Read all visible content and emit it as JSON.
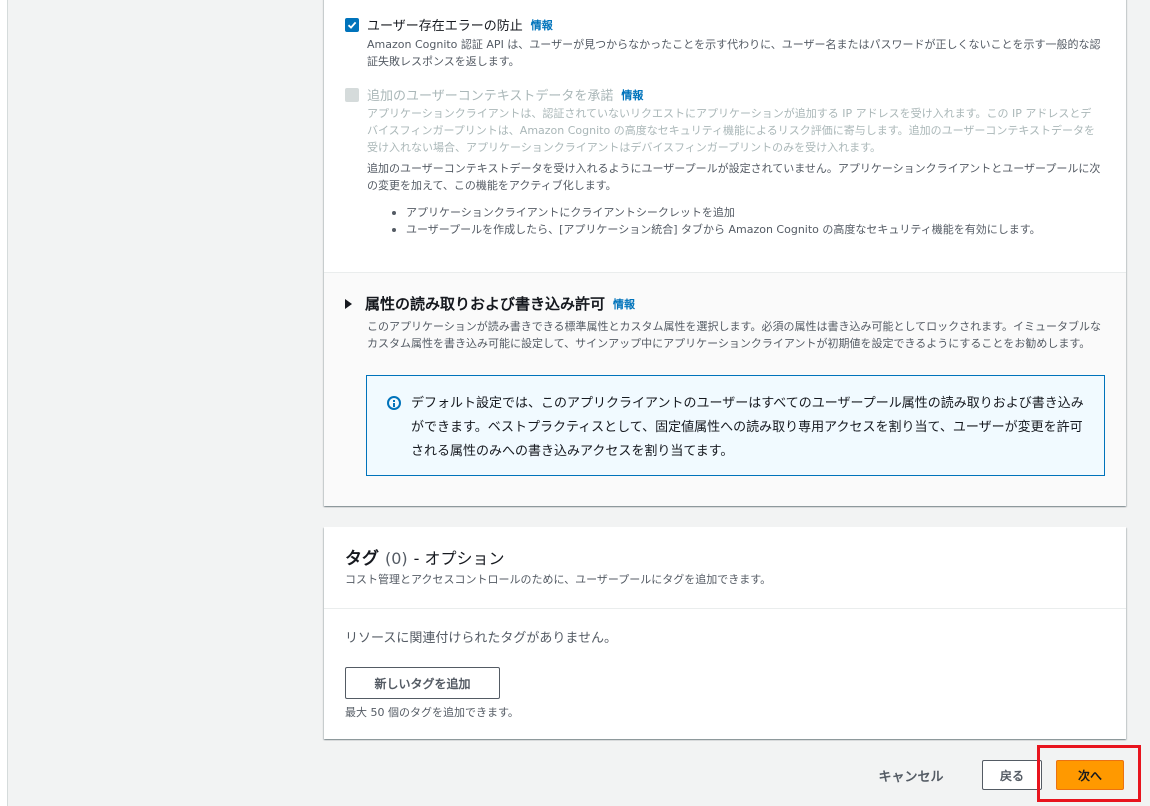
{
  "colors": {
    "link": "#0073bb",
    "primary_button": "#ff9900",
    "highlight_box": "#e8141e",
    "checkbox_checked": "#0073bb"
  },
  "settings": {
    "prevent_user_existence": {
      "label": "ユーザー存在エラーの防止",
      "info": "情報",
      "checked": true,
      "description": "Amazon Cognito 認証 API は、ユーザーが見つからなかったことを示す代わりに、ユーザー名またはパスワードが正しくないことを示す一般的な認証失敗レスポンスを返します。"
    },
    "user_context_data": {
      "label": "追加のユーザーコンテキストデータを承諾",
      "info": "情報",
      "checked": false,
      "disabled": true,
      "description": "アプリケーションクライアントは、認証されていないリクエストにアプリケーションが追加する IP アドレスを受け入れます。この IP アドレスとデバイスフィンガープリントは、Amazon Cognito の高度なセキュリティ機能によるリスク評価に寄与します。追加のユーザーコンテキストデータを受け入れない場合、アプリケーションクライアントはデバイスフィンガープリントのみを受け入れます。",
      "note": "追加のユーザーコンテキストデータを受け入れるようにユーザープールが設定されていません。アプリケーションクライアントとユーザープールに次の変更を加えて、この機能をアクティブ化します。",
      "bullets": [
        "アプリケーションクライアントにクライアントシークレットを追加",
        "ユーザープールを作成したら、[アプリケーション統合] タブから Amazon Cognito の高度なセキュリティ機能を有効にします。"
      ]
    }
  },
  "attributes_section": {
    "title": "属性の読み取りおよび書き込み許可",
    "info": "情報",
    "description": "このアプリケーションが読み書きできる標準属性とカスタム属性を選択します。必須の属性は書き込み可能としてロックされます。イミュータブルなカスタム属性を書き込み可能に設定して、サインアップ中にアプリケーションクライアントが初期値を設定できるようにすることをお勧めします。",
    "alert": "デフォルト設定では、このアプリクライアントのユーザーはすべてのユーザープール属性の読み取りおよび書き込みができます。ベストプラクティスとして、固定値属性への読み取り専用アクセスを割り当て、ユーザーが変更を許可される属性のみへの書き込みアクセスを割り当てます。"
  },
  "tags": {
    "title": "タグ",
    "count": "(0)",
    "suffix": "- オプション",
    "description": "コスト管理とアクセスコントロールのために、ユーザープールにタグを追加できます。",
    "empty": "リソースに関連付けられたタグがありません。",
    "add_button": "新しいタグを追加",
    "limit": "最大 50 個のタグを追加できます。"
  },
  "footer": {
    "cancel": "キャンセル",
    "back": "戻る",
    "next": "次へ"
  }
}
